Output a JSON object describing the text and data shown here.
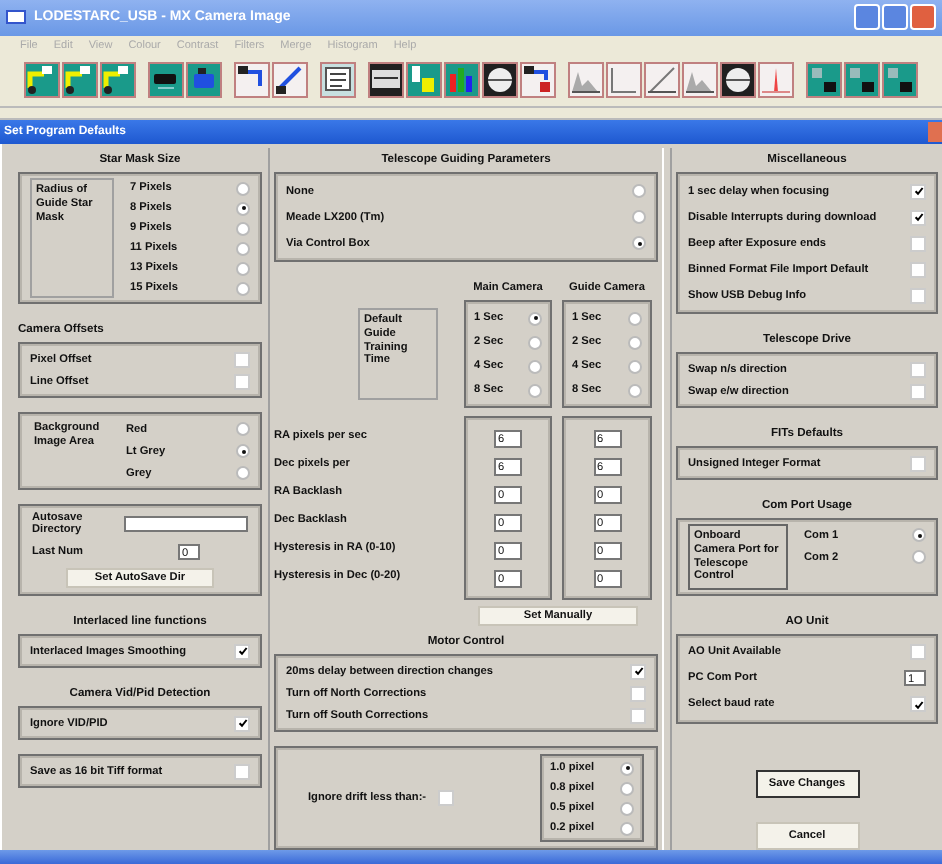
{
  "app_window": {
    "title": "LODESTARC_USB - MX Camera Image",
    "menu": [
      "File",
      "Edit",
      "View",
      "Colour",
      "Contrast",
      "Filters",
      "Merge",
      "Histogram",
      "Help"
    ]
  },
  "dialog": {
    "title": "Set Program Defaults",
    "columns": [
      {
        "blocks": [
          {
            "kind": "heading",
            "text": "Star Mask Size"
          },
          {
            "kind": "box",
            "label": "Radius of Guide Star Mask",
            "label_framed": true,
            "rows": [
              {
                "kind": "radio",
                "label": "7 Pixels",
                "selected": false
              },
              {
                "kind": "radio",
                "label": "8 Pixels",
                "selected": true
              },
              {
                "kind": "radio",
                "label": "9 Pixels",
                "selected": false
              },
              {
                "kind": "radio",
                "label": "11 Pixels",
                "selected": false
              },
              {
                "kind": "radio",
                "label": "13 Pixels",
                "selected": false
              },
              {
                "kind": "radio",
                "label": "15 Pixels",
                "selected": false
              }
            ]
          },
          {
            "kind": "heading",
            "text": "Camera Offsets"
          },
          {
            "kind": "box",
            "rows": [
              {
                "kind": "check",
                "label": "Pixel Offset",
                "checked": false
              },
              {
                "kind": "check",
                "label": "Line Offset",
                "checked": false
              }
            ]
          },
          {
            "kind": "box",
            "label": "Background Image Area",
            "label_framed": false,
            "rows": [
              {
                "kind": "radio",
                "label": "Red",
                "selected": false
              },
              {
                "kind": "radio",
                "label": "Lt Grey",
                "selected": true
              },
              {
                "kind": "radio",
                "label": "Grey",
                "selected": false
              }
            ]
          },
          {
            "kind": "autosave",
            "directory_label": "Autosave Directory",
            "last_num_label": "Last Num",
            "last_num": "0",
            "button": "Set AutoSave Dir"
          },
          {
            "kind": "heading",
            "text": "Interlaced line functions"
          },
          {
            "kind": "box",
            "rows": [
              {
                "kind": "check",
                "label": "Interlaced Images Smoothing",
                "checked": true
              }
            ]
          },
          {
            "kind": "heading",
            "text": "Camera Vid/Pid Detection"
          },
          {
            "kind": "box",
            "rows": [
              {
                "kind": "check",
                "label": "Ignore VID/PID",
                "checked": true
              }
            ]
          },
          {
            "kind": "box",
            "rows": [
              {
                "kind": "check",
                "label": "Save as 16 bit Tiff format",
                "checked": false
              }
            ]
          }
        ]
      },
      {
        "blocks": [
          {
            "kind": "heading",
            "text": "Telescope Guiding Parameters"
          },
          {
            "kind": "box",
            "rows": [
              {
                "kind": "radio",
                "label": "None",
                "selected": false
              },
              {
                "kind": "radio",
                "label": "Meade LX200 (Tm)",
                "selected": false
              },
              {
                "kind": "radio",
                "label": "Via Control Box",
                "selected": true
              }
            ]
          },
          {
            "kind": "training",
            "main_heading": "Main Camera",
            "guide_heading": "Guide Camera",
            "label": "Default Guide Training Time",
            "main_times": [
              {
                "label": "1 Sec",
                "selected": true
              },
              {
                "label": "2 Sec",
                "selected": false
              },
              {
                "label": "4 Sec",
                "selected": false
              },
              {
                "label": "8 Sec",
                "selected": false
              }
            ],
            "guide_times": [
              {
                "label": "1 Sec",
                "selected": false
              },
              {
                "label": "2 Sec",
                "selected": false
              },
              {
                "label": "4 Sec",
                "selected": false
              },
              {
                "label": "8 Sec",
                "selected": false
              }
            ],
            "params": [
              {
                "label": "RA pixels per sec",
                "main": "6",
                "guide": "6"
              },
              {
                "label": "Dec pixels per",
                "main": "6",
                "guide": "6"
              },
              {
                "label": "RA Backlash",
                "main": "0",
                "guide": "0"
              },
              {
                "label": "Dec Backlash",
                "main": "0",
                "guide": "0"
              },
              {
                "label": "Hysteresis in RA (0-10)",
                "main": "0",
                "guide": "0"
              },
              {
                "label": "Hysteresis in Dec (0-20)",
                "main": "0",
                "guide": "0"
              }
            ],
            "button": "Set Manually"
          },
          {
            "kind": "heading",
            "text": "Motor Control"
          },
          {
            "kind": "box",
            "rows": [
              {
                "kind": "check",
                "label": "20ms delay between direction changes",
                "checked": true
              },
              {
                "kind": "check",
                "label": "Turn off North Corrections",
                "checked": false
              },
              {
                "kind": "check",
                "label": "Turn off South Corrections",
                "checked": false
              }
            ]
          },
          {
            "kind": "drift",
            "label": "Ignore drift less than:-",
            "checked": false,
            "options": [
              {
                "label": "1.0 pixel",
                "selected": true
              },
              {
                "label": "0.8 pixel",
                "selected": false
              },
              {
                "label": "0.5 pixel",
                "selected": false
              },
              {
                "label": "0.2 pixel",
                "selected": false
              }
            ]
          }
        ]
      },
      {
        "blocks": [
          {
            "kind": "heading",
            "text": "Miscellaneous"
          },
          {
            "kind": "box",
            "rows": [
              {
                "kind": "check",
                "label": "1 sec delay when focusing",
                "checked": true
              },
              {
                "kind": "check",
                "label": "Disable Interrupts during download",
                "checked": true
              },
              {
                "kind": "check",
                "label": "Beep after Exposure ends",
                "checked": false
              },
              {
                "kind": "check",
                "label": "Binned Format File Import Default",
                "checked": false
              },
              {
                "kind": "check",
                "label": "Show USB Debug Info",
                "checked": false
              }
            ]
          },
          {
            "kind": "heading",
            "text": "Telescope Drive"
          },
          {
            "kind": "box",
            "rows": [
              {
                "kind": "check",
                "label": "Swap n/s direction",
                "checked": false
              },
              {
                "kind": "check",
                "label": "Swap e/w direction",
                "checked": false
              }
            ]
          },
          {
            "kind": "heading",
            "text": "FITs Defaults"
          },
          {
            "kind": "box",
            "rows": [
              {
                "kind": "check",
                "label": "Unsigned Integer Format",
                "checked": false
              }
            ]
          },
          {
            "kind": "heading",
            "text": "Com Port Usage"
          },
          {
            "kind": "box",
            "label": "Onboard Camera Port for Telescope Control",
            "label_framed": true,
            "rows": [
              {
                "kind": "radio",
                "label": "Com 1",
                "selected": true
              },
              {
                "kind": "radio",
                "label": "Com 2",
                "selected": false
              }
            ]
          },
          {
            "kind": "heading",
            "text": "AO Unit"
          },
          {
            "kind": "box",
            "rows": [
              {
                "kind": "check",
                "label": "AO Unit Available",
                "checked": false
              },
              {
                "kind": "field",
                "label": "PC Com Port",
                "value": "1"
              },
              {
                "kind": "check",
                "label": "Select baud rate",
                "checked": true
              }
            ]
          },
          {
            "kind": "buttons",
            "items": [
              "Save Changes",
              "Cancel"
            ]
          }
        ]
      }
    ]
  }
}
